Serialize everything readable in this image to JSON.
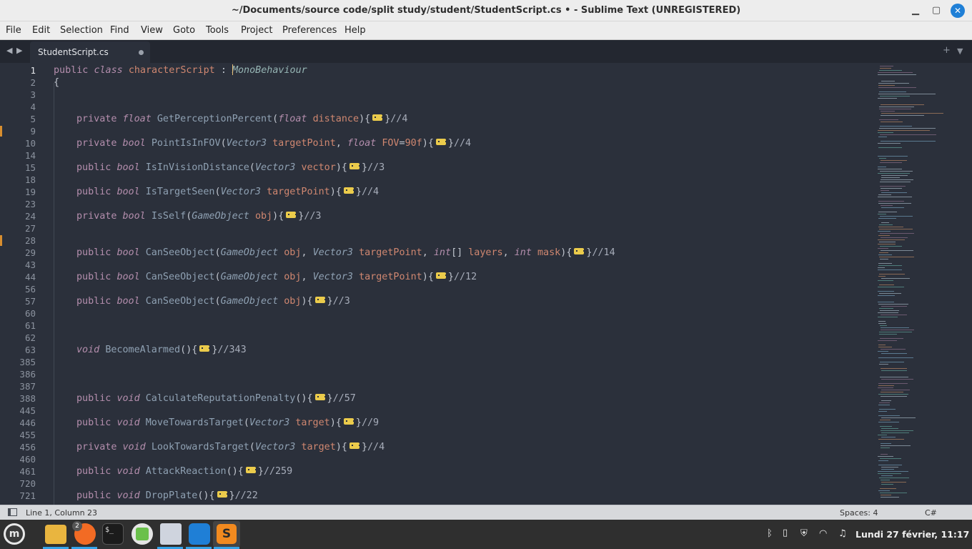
{
  "window": {
    "title": "~/Documents/source code/split study/student/StudentScript.cs • - Sublime Text (UNREGISTERED)",
    "minimize_icon": "minimize-icon",
    "maximize_icon": "maximize-icon",
    "close_icon": "close-icon"
  },
  "menu": {
    "items": [
      "File",
      "Edit",
      "Selection",
      "Find",
      "View",
      "Goto",
      "Tools",
      "Project",
      "Preferences",
      "Help"
    ]
  },
  "tabs": {
    "nav_left_icon": "triangle-left-icon",
    "nav_right_icon": "triangle-right-icon",
    "active": {
      "label": "StudentScript.cs",
      "modified": true
    },
    "new_tab_icon": "plus-icon",
    "dropdown_icon": "chevron-down-icon"
  },
  "editor": {
    "active_line": "1",
    "lines": [
      {
        "num": "1",
        "code": "public class characterScript : MonoBehaviour"
      },
      {
        "num": "2",
        "code": "{"
      },
      {
        "num": "3",
        "code": ""
      },
      {
        "num": "4",
        "code": ""
      },
      {
        "num": "5",
        "code": "private float GetPerceptionPercent(float distance){…}//4"
      },
      {
        "num": "9",
        "code": ""
      },
      {
        "num": "10",
        "code": "private bool PointIsInFOV(Vector3 targetPoint, float FOV=90f){…}//4"
      },
      {
        "num": "14",
        "code": ""
      },
      {
        "num": "15",
        "code": "public bool IsInVisionDistance(Vector3 vector){…}//3"
      },
      {
        "num": "18",
        "code": ""
      },
      {
        "num": "19",
        "code": "public bool IsTargetSeen(Vector3 targetPoint){…}//4"
      },
      {
        "num": "23",
        "code": ""
      },
      {
        "num": "24",
        "code": "private bool IsSelf(GameObject obj){…}//3"
      },
      {
        "num": "27",
        "code": ""
      },
      {
        "num": "28",
        "code": ""
      },
      {
        "num": "29",
        "code": "public bool CanSeeObject(GameObject obj, Vector3 targetPoint, int[] layers, int mask){…}//14"
      },
      {
        "num": "43",
        "code": ""
      },
      {
        "num": "44",
        "code": "public bool CanSeeObject(GameObject obj, Vector3 targetPoint){…}//12"
      },
      {
        "num": "56",
        "code": ""
      },
      {
        "num": "57",
        "code": "public bool CanSeeObject(GameObject obj){…}//3"
      },
      {
        "num": "60",
        "code": ""
      },
      {
        "num": "61",
        "code": ""
      },
      {
        "num": "62",
        "code": ""
      },
      {
        "num": "63",
        "code": "void BecomeAlarmed(){…}//343"
      },
      {
        "num": "385",
        "code": ""
      },
      {
        "num": "386",
        "code": ""
      },
      {
        "num": "387",
        "code": ""
      },
      {
        "num": "388",
        "code": "public void CalculateReputationPenalty(){…}//57"
      },
      {
        "num": "445",
        "code": ""
      },
      {
        "num": "446",
        "code": "public void MoveTowardsTarget(Vector3 target){…}//9"
      },
      {
        "num": "455",
        "code": ""
      },
      {
        "num": "456",
        "code": "private void LookTowardsTarget(Vector3 target){…}//4"
      },
      {
        "num": "460",
        "code": ""
      },
      {
        "num": "461",
        "code": "public void AttackReaction(){…}//259"
      },
      {
        "num": "720",
        "code": ""
      },
      {
        "num": "721",
        "code": "public void DropPlate(){…}//22"
      }
    ]
  },
  "status": {
    "panel_icon": "panel-toggle-icon",
    "position": "Line 1, Column 23",
    "indent": "Spaces: 4",
    "syntax": "C#"
  },
  "taskbar": {
    "apps": [
      "mint-menu-icon",
      "files-icon",
      "firefox-icon",
      "terminal-icon",
      "calculator-icon",
      "text-editor-icon",
      "vscode-icon",
      "sublime-text-icon"
    ],
    "firefox_badge": "2",
    "terminal_glyph": "$_",
    "sublime_glyph": "S",
    "tray": [
      "bluetooth-icon",
      "clipboard-icon",
      "shield-icon",
      "wifi-icon",
      "music-icon"
    ],
    "clock": "Lundi 27 février, 11:17"
  },
  "colors": {
    "editor_bg": "#2b303b",
    "keyword": "#b48ead",
    "function": "#8fa1b3",
    "class": "#d08770",
    "fold_marker": "#ebcb4b",
    "accent_taskbar": "#35a3e8"
  }
}
